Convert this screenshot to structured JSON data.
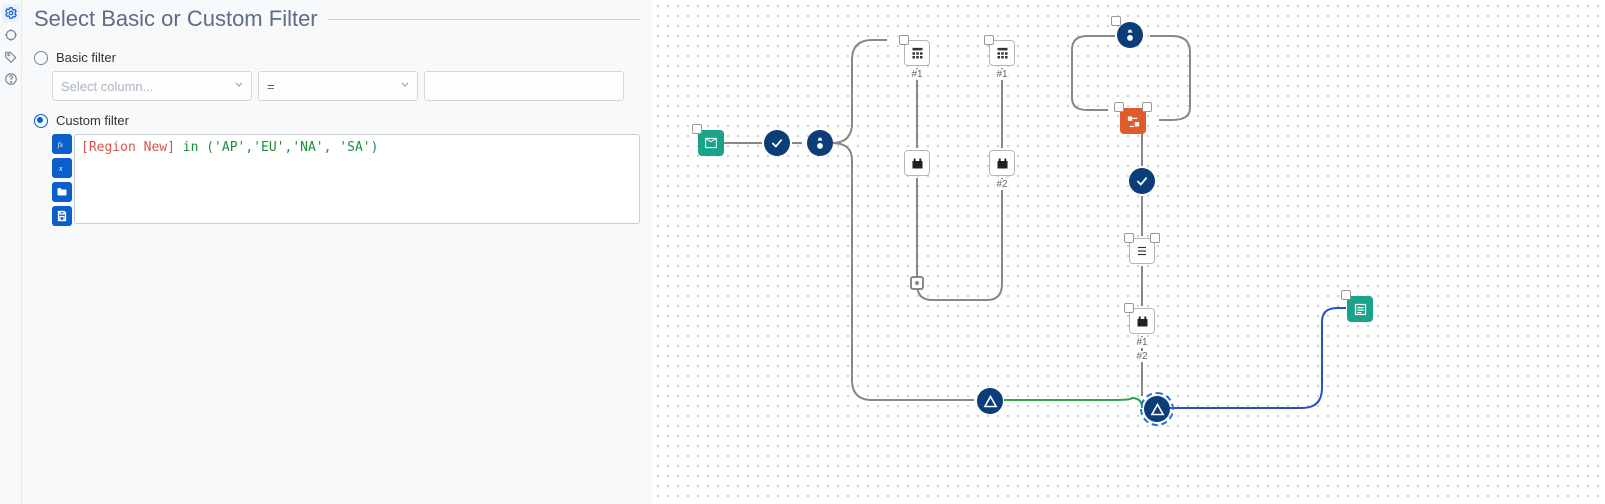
{
  "panel": {
    "title": "Select Basic or Custom Filter",
    "basic_label": "Basic filter",
    "custom_label": "Custom filter",
    "selected": "custom",
    "basic": {
      "column_placeholder": "Select column...",
      "operator": "=",
      "value": ""
    },
    "expression": {
      "field_token": "[Region New]",
      "keyword_token": "in",
      "args_token": "('AP','EU','NA', 'SA')"
    }
  },
  "side_rail": [
    "gear",
    "target",
    "tag",
    "help"
  ],
  "canvas_labels": {
    "h1": "#1",
    "h11": "#1",
    "h2": "#2",
    "h21": "#2",
    "h12": "#1"
  }
}
